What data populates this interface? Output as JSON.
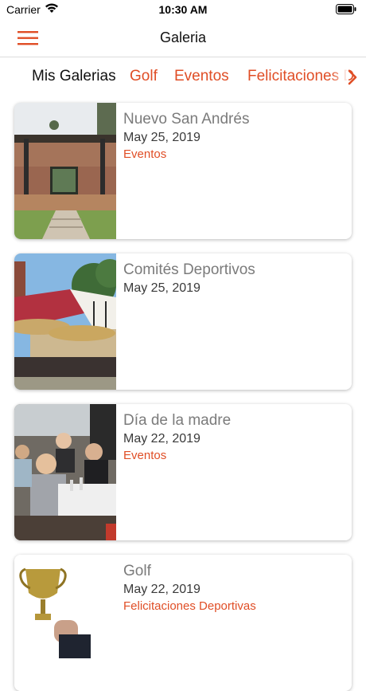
{
  "status_bar": {
    "carrier": "Carrier",
    "time": "10:30 AM"
  },
  "nav": {
    "title": "Galeria",
    "menu_icon": "hamburger-menu-icon"
  },
  "tabs": [
    {
      "label": "Mis Galerias",
      "active": true
    },
    {
      "label": "Golf",
      "active": false
    },
    {
      "label": "Eventos",
      "active": false
    },
    {
      "label": "Felicitaciones D",
      "active": false
    }
  ],
  "galleries": [
    {
      "name": "Nuevo San Andrés",
      "date": "May 25, 2019",
      "category": "Eventos"
    },
    {
      "name": "Comités Deportivos",
      "date": "May 25, 2019",
      "category": ""
    },
    {
      "name": "Día de la madre",
      "date": "May 22, 2019",
      "category": "Eventos"
    },
    {
      "name": "Golf",
      "date": "May 22, 2019",
      "category": "Felicitaciones Deportivas"
    }
  ],
  "colors": {
    "accent": "#e04e26",
    "title_text": "#7b7b7b",
    "date_text": "#3a3a3a"
  }
}
